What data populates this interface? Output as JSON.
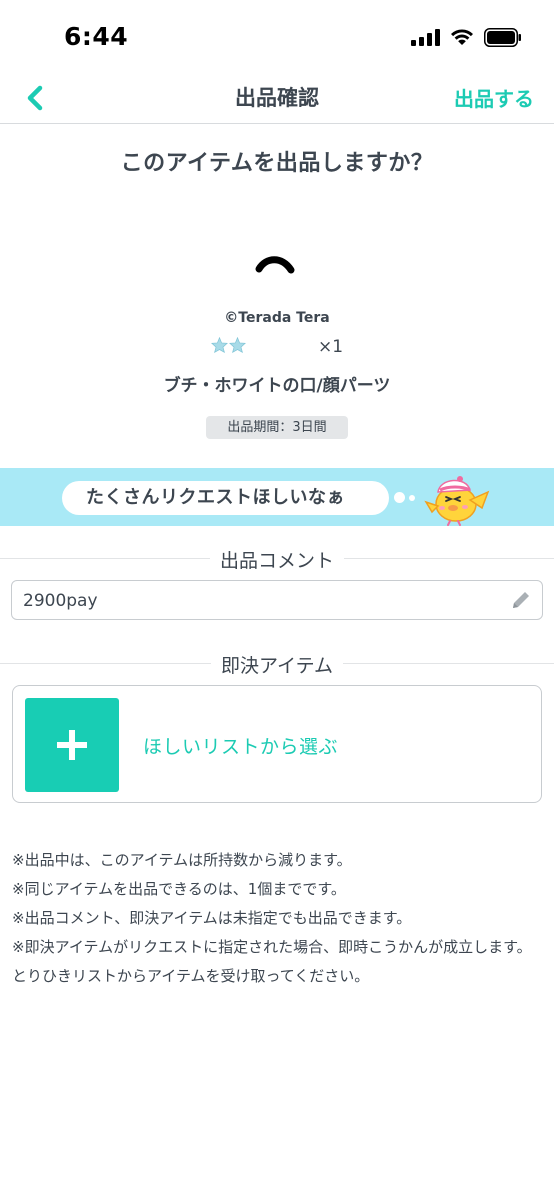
{
  "status_bar": {
    "time": "6:44"
  },
  "nav": {
    "title": "出品確認",
    "submit_label": "出品する"
  },
  "question": "このアイテムを出品しますか？",
  "item": {
    "copyright": "©Terada Tera",
    "rarity_stars": 2,
    "quantity": "×1",
    "name": "ブチ・ホワイトの口/顔パーツ",
    "period": "出品期間：3日間"
  },
  "banner": {
    "text": "たくさんリクエストほしいなぁ"
  },
  "comment_section": {
    "label": "出品コメント",
    "value": "2900pay"
  },
  "quick_section": {
    "label": "即決アイテム",
    "choose_label": "ほしいリストから選ぶ"
  },
  "notes": [
    "※出品中は、このアイテムは所持数から減ります。",
    "※同じアイテムを出品できるのは、1個までです。",
    "※出品コメント、即決アイテムは未指定でも出品できます。",
    "※即決アイテムがリクエストに指定された場合、即時こうかんが成立します。とりひきリストからアイテムを受け取ってください。"
  ],
  "colors": {
    "accent": "#1ccbb3",
    "banner": "#a9e9f6",
    "text": "#3d4650"
  }
}
